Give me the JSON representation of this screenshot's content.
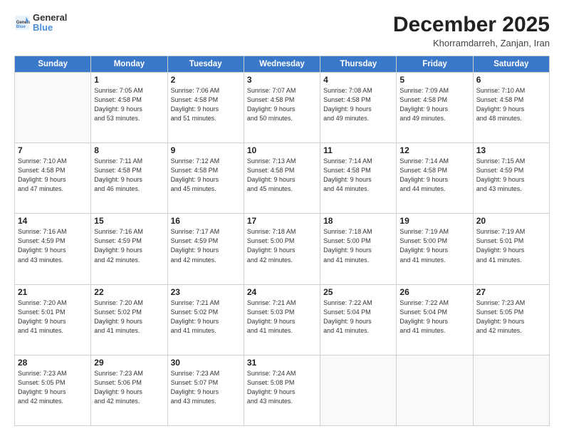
{
  "header": {
    "logo_general": "General",
    "logo_blue": "Blue",
    "month_title": "December 2025",
    "subtitle": "Khorramdarreh, Zanjan, Iran"
  },
  "days_of_week": [
    "Sunday",
    "Monday",
    "Tuesday",
    "Wednesday",
    "Thursday",
    "Friday",
    "Saturday"
  ],
  "weeks": [
    [
      {
        "day": "",
        "info": ""
      },
      {
        "day": "1",
        "info": "Sunrise: 7:05 AM\nSunset: 4:58 PM\nDaylight: 9 hours\nand 53 minutes."
      },
      {
        "day": "2",
        "info": "Sunrise: 7:06 AM\nSunset: 4:58 PM\nDaylight: 9 hours\nand 51 minutes."
      },
      {
        "day": "3",
        "info": "Sunrise: 7:07 AM\nSunset: 4:58 PM\nDaylight: 9 hours\nand 50 minutes."
      },
      {
        "day": "4",
        "info": "Sunrise: 7:08 AM\nSunset: 4:58 PM\nDaylight: 9 hours\nand 49 minutes."
      },
      {
        "day": "5",
        "info": "Sunrise: 7:09 AM\nSunset: 4:58 PM\nDaylight: 9 hours\nand 49 minutes."
      },
      {
        "day": "6",
        "info": "Sunrise: 7:10 AM\nSunset: 4:58 PM\nDaylight: 9 hours\nand 48 minutes."
      }
    ],
    [
      {
        "day": "7",
        "info": "Sunrise: 7:10 AM\nSunset: 4:58 PM\nDaylight: 9 hours\nand 47 minutes."
      },
      {
        "day": "8",
        "info": "Sunrise: 7:11 AM\nSunset: 4:58 PM\nDaylight: 9 hours\nand 46 minutes."
      },
      {
        "day": "9",
        "info": "Sunrise: 7:12 AM\nSunset: 4:58 PM\nDaylight: 9 hours\nand 45 minutes."
      },
      {
        "day": "10",
        "info": "Sunrise: 7:13 AM\nSunset: 4:58 PM\nDaylight: 9 hours\nand 45 minutes."
      },
      {
        "day": "11",
        "info": "Sunrise: 7:14 AM\nSunset: 4:58 PM\nDaylight: 9 hours\nand 44 minutes."
      },
      {
        "day": "12",
        "info": "Sunrise: 7:14 AM\nSunset: 4:58 PM\nDaylight: 9 hours\nand 44 minutes."
      },
      {
        "day": "13",
        "info": "Sunrise: 7:15 AM\nSunset: 4:59 PM\nDaylight: 9 hours\nand 43 minutes."
      }
    ],
    [
      {
        "day": "14",
        "info": "Sunrise: 7:16 AM\nSunset: 4:59 PM\nDaylight: 9 hours\nand 43 minutes."
      },
      {
        "day": "15",
        "info": "Sunrise: 7:16 AM\nSunset: 4:59 PM\nDaylight: 9 hours\nand 42 minutes."
      },
      {
        "day": "16",
        "info": "Sunrise: 7:17 AM\nSunset: 4:59 PM\nDaylight: 9 hours\nand 42 minutes."
      },
      {
        "day": "17",
        "info": "Sunrise: 7:18 AM\nSunset: 5:00 PM\nDaylight: 9 hours\nand 42 minutes."
      },
      {
        "day": "18",
        "info": "Sunrise: 7:18 AM\nSunset: 5:00 PM\nDaylight: 9 hours\nand 41 minutes."
      },
      {
        "day": "19",
        "info": "Sunrise: 7:19 AM\nSunset: 5:00 PM\nDaylight: 9 hours\nand 41 minutes."
      },
      {
        "day": "20",
        "info": "Sunrise: 7:19 AM\nSunset: 5:01 PM\nDaylight: 9 hours\nand 41 minutes."
      }
    ],
    [
      {
        "day": "21",
        "info": "Sunrise: 7:20 AM\nSunset: 5:01 PM\nDaylight: 9 hours\nand 41 minutes."
      },
      {
        "day": "22",
        "info": "Sunrise: 7:20 AM\nSunset: 5:02 PM\nDaylight: 9 hours\nand 41 minutes."
      },
      {
        "day": "23",
        "info": "Sunrise: 7:21 AM\nSunset: 5:02 PM\nDaylight: 9 hours\nand 41 minutes."
      },
      {
        "day": "24",
        "info": "Sunrise: 7:21 AM\nSunset: 5:03 PM\nDaylight: 9 hours\nand 41 minutes."
      },
      {
        "day": "25",
        "info": "Sunrise: 7:22 AM\nSunset: 5:04 PM\nDaylight: 9 hours\nand 41 minutes."
      },
      {
        "day": "26",
        "info": "Sunrise: 7:22 AM\nSunset: 5:04 PM\nDaylight: 9 hours\nand 41 minutes."
      },
      {
        "day": "27",
        "info": "Sunrise: 7:23 AM\nSunset: 5:05 PM\nDaylight: 9 hours\nand 42 minutes."
      }
    ],
    [
      {
        "day": "28",
        "info": "Sunrise: 7:23 AM\nSunset: 5:05 PM\nDaylight: 9 hours\nand 42 minutes."
      },
      {
        "day": "29",
        "info": "Sunrise: 7:23 AM\nSunset: 5:06 PM\nDaylight: 9 hours\nand 42 minutes."
      },
      {
        "day": "30",
        "info": "Sunrise: 7:23 AM\nSunset: 5:07 PM\nDaylight: 9 hours\nand 43 minutes."
      },
      {
        "day": "31",
        "info": "Sunrise: 7:24 AM\nSunset: 5:08 PM\nDaylight: 9 hours\nand 43 minutes."
      },
      {
        "day": "",
        "info": ""
      },
      {
        "day": "",
        "info": ""
      },
      {
        "day": "",
        "info": ""
      }
    ]
  ]
}
